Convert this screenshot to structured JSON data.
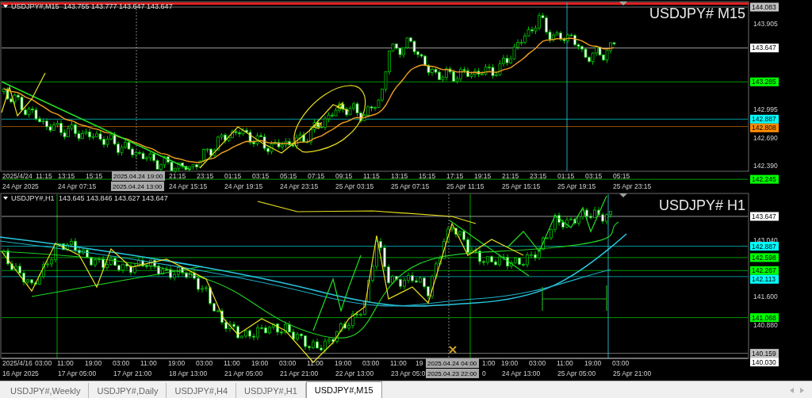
{
  "panels": [
    {
      "symbol": "USDJPY#,M15",
      "ohlc": "143.755 143.777 143.647 143.647",
      "title": "USDJPY# M15",
      "price_ticks": [
        "143.905",
        "142.995",
        "142.690",
        "142.390"
      ],
      "price_levels": [
        {
          "label": "144.083",
          "color": "#c0c0c0"
        },
        {
          "label": "143.647",
          "color": "#ffffff"
        },
        {
          "label": "143.285",
          "color": "#00ff00"
        },
        {
          "label": "142.887",
          "color": "#00ffff"
        },
        {
          "label": "142.808",
          "color": "#ff8c00"
        },
        {
          "label": "142.245",
          "color": "#00ff00"
        }
      ],
      "time_start": "2025/4/24",
      "time_row_1": [
        "11:15",
        "13:15",
        "15:15",
        "21:15",
        "23:15",
        "01:15",
        "03:15",
        "05:15",
        "07:15",
        "09:15",
        "11:15",
        "13:15",
        "15:15",
        "17:15",
        "19:15",
        "21:15",
        "23:15",
        "01:15",
        "03:15",
        "05:15"
      ],
      "cursor_time_1": "2025.04.24 19:00",
      "time_row_2": [
        "24 Apr 2025",
        "24 Apr 07:15",
        "24 Apr 15:15",
        "24 Apr 19:15",
        "24 Apr 23:15",
        "25 Apr 03:15",
        "25 Apr 07:15",
        "25 Apr 11:15",
        "25 Apr 15:15",
        "25 Apr 19:15",
        "25 Apr 23:15"
      ],
      "cursor_time_2": "2025.04.24 13:00"
    },
    {
      "symbol": "USDJPY#,H1",
      "ohlc": "143.645 143.846 143.627 143.647",
      "title": "USDJPY# H1",
      "price_ticks": [
        "143.040",
        "141.600",
        "140.880"
      ],
      "price_levels": [
        {
          "label": "143.647",
          "color": "#ffffff"
        },
        {
          "label": "142.887",
          "color": "#00ffff"
        },
        {
          "label": "142.598",
          "color": "#00ff00"
        },
        {
          "label": "142.267",
          "color": "#00ff00"
        },
        {
          "label": "142.113",
          "color": "#00ffff"
        },
        {
          "label": "141.068",
          "color": "#00ff00"
        },
        {
          "label": "140.159",
          "color": "#c0c0c0"
        },
        {
          "label": "140.030",
          "color": "#ffffff"
        }
      ],
      "time_start": "2025/4/16",
      "time_row_1": [
        "03:00",
        "11:00",
        "19:00",
        "03:00",
        "11:00",
        "19:00",
        "03:00",
        "11:00",
        "19:00",
        "03:00",
        "11:00",
        "19:00",
        "03:00",
        "11:00",
        "19",
        "1:00",
        "19:00",
        "03:00",
        "11:00",
        "19:00",
        "03:00"
      ],
      "cursor_time_1": "2025.04.24 04:00",
      "time_row_2": [
        "16 Apr 2025",
        "17 Apr 05:00",
        "17 Apr 21:00",
        "18 Apr 13:00",
        "21 Apr 05:00",
        "21 Apr 21:00",
        "22 Apr 13:00",
        "23 Apr 05:0",
        "0",
        "24 Apr 13:00",
        "25 Apr 05:00",
        "25 Apr 21:00"
      ],
      "cursor_time_2": "2025.04.23 22:00"
    }
  ],
  "tabs": [
    {
      "label": "USDJPY#,Weekly",
      "selected": false
    },
    {
      "label": "USDJPY#,Daily",
      "selected": false
    },
    {
      "label": "USDJPY#,H4",
      "selected": false
    },
    {
      "label": "USDJPY#,H1",
      "selected": false
    },
    {
      "label": "USDJPY#,M15",
      "selected": true
    }
  ]
}
